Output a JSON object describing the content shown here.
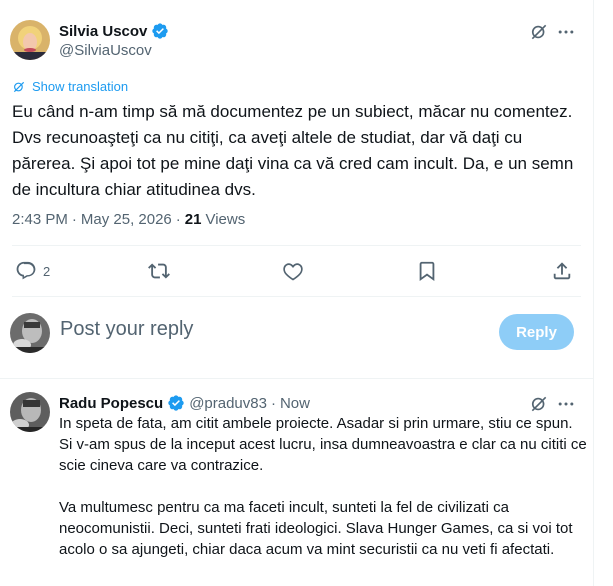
{
  "tweet": {
    "author_name": "Silvia Uscov",
    "author_handle": "@SilviaUscov",
    "show_translation": "Show translation",
    "text": "Eu când n-am timp să mă documentez pe un subiect, măcar nu comentez. Dvs recunoaşteţi ca nu citiţi, ca aveţi altele de studiat, dar vă daţi cu părerea. Şi apoi tot pe mine daţi vina ca vă cred cam incult. Da, e un semn de incultura chiar atitudinea dvs.",
    "time": "2:43 PM",
    "separator": "·",
    "date": "May 25, 2026",
    "views_count": "21",
    "views_label": "Views",
    "reply_count": "2"
  },
  "composer": {
    "placeholder": "Post your reply",
    "reply_button": "Reply"
  },
  "reply": {
    "author_name": "Radu Popescu",
    "author_handle": "@praduv83",
    "separator": "·",
    "time": "Now",
    "paragraphs": [
      "In speta de fata, am citit ambele proiecte. Asadar si prin urmare, stiu ce spun. Si v-am spus de la inceput acest lucru, insa dumneavoastra e clar ca nu cititi ce scie cineva care va contrazice.",
      "Va multumesc pentru ca ma faceti incult, sunteti la fel de civilizati ca neocomunistii. Deci, sunteti frati ideologici. Slava Hunger Games, ca si voi tot acolo o sa ajungeti, chiar daca acum va mint securistii ca nu veti fi afectati."
    ]
  },
  "icons": {
    "verified": "verified-badge-icon",
    "grok": "grok-icon",
    "more": "more-icon",
    "translate": "translate-icon",
    "reply": "reply-icon",
    "repost": "repost-icon",
    "like": "like-icon",
    "bookmark": "bookmark-icon",
    "share": "share-icon"
  },
  "colors": {
    "accent": "#1d9bf0",
    "text_primary": "#0f1419",
    "text_secondary": "#536471",
    "reply_button_disabled": "#8ecdf7",
    "divider": "#eff3f4"
  }
}
